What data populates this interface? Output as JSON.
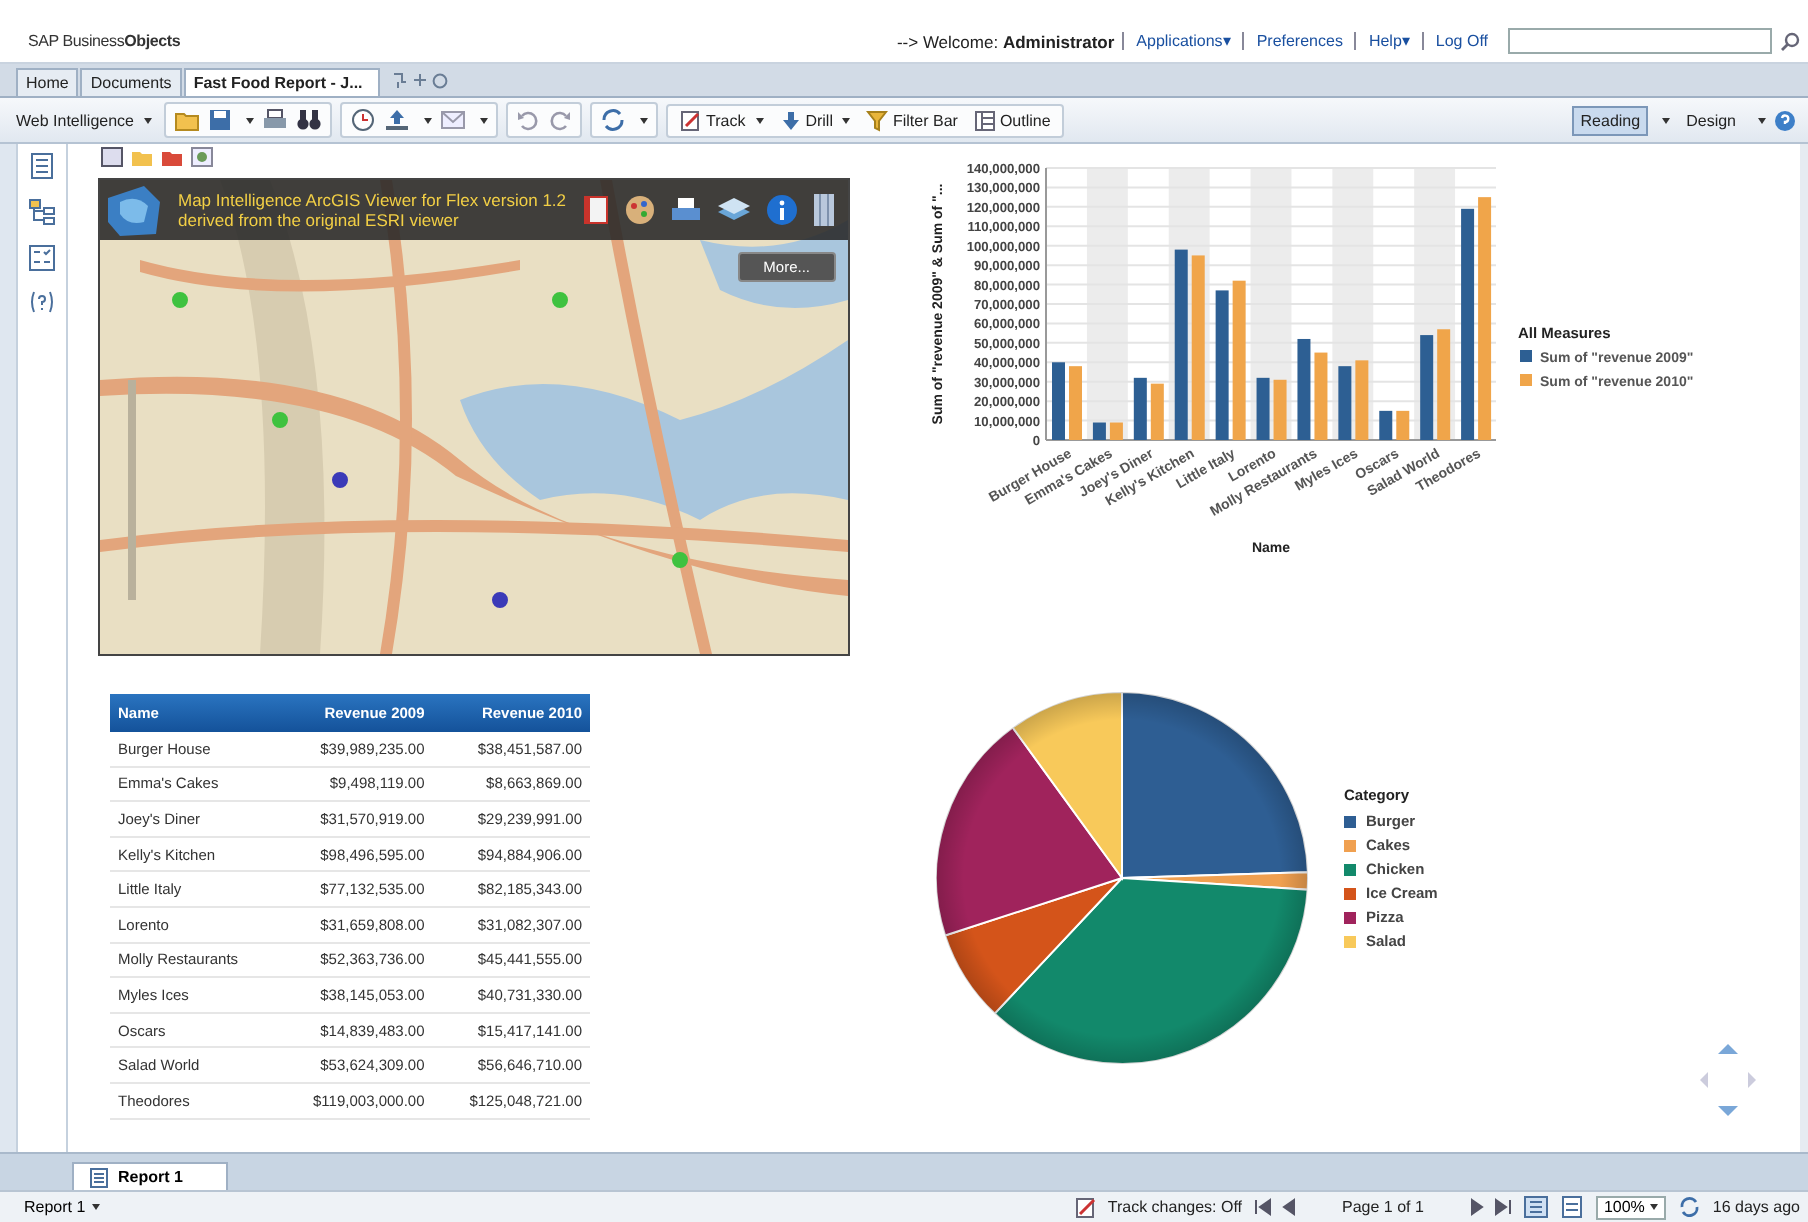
{
  "header": {
    "logo": "SAP Business**Objects**",
    "welcome_prefix": "--> Welcome:",
    "user": "Administrator",
    "links": [
      {
        "label": "Applications▾"
      },
      {
        "label": "Preferences"
      },
      {
        "label": "Help▾"
      },
      {
        "label": "Log Off"
      }
    ]
  },
  "tabs": [
    {
      "label": "Home",
      "selected": false
    },
    {
      "label": "Documents",
      "selected": false
    },
    {
      "label": "Fast Food Report - J...",
      "selected": true
    }
  ],
  "toolbar": {
    "app_menu": "Web Intelligence",
    "tools": [
      "Track",
      "Drill",
      "Filter Bar",
      "Outline"
    ],
    "views": [
      {
        "label": "Reading",
        "selected": true
      },
      {
        "label": "Design",
        "selected": false
      }
    ]
  },
  "map": {
    "kind": "picture",
    "title": "Map Intelligence ArcGIS Viewer for Flex version 1.2",
    "subtitle": "derived from the original ESRI viewer",
    "more_button": "More..."
  },
  "bar_chart": {
    "legend_title": "All Measures",
    "chart_data": {
      "type": "bar",
      "xlabel": "Name",
      "ylabel": "Sum of \"revenue 2009\" & Sum of \"...",
      "categories": [
        "Burger House",
        "Emma's Cakes",
        "Joey's Diner",
        "Kelly's Kitchen",
        "Little Italy",
        "Lorento",
        "Molly Restaurants",
        "Myles Ices",
        "Oscars",
        "Salad World",
        "Theodores"
      ],
      "series": [
        {
          "name": "Sum of \"revenue 2009\"",
          "color": "#2d5f93",
          "values": [
            40000000,
            9000000,
            32000000,
            98000000,
            77000000,
            32000000,
            52000000,
            38000000,
            15000000,
            54000000,
            119000000
          ]
        },
        {
          "name": "Sum of \"revenue 2010\"",
          "color": "#f0a54a",
          "values": [
            38000000,
            9000000,
            29000000,
            95000000,
            82000000,
            31000000,
            45000000,
            41000000,
            15000000,
            57000000,
            125000000
          ]
        }
      ],
      "grid": true,
      "legend": true,
      "ylim": [
        0,
        140000000
      ],
      "yticks": [
        {
          "value": 0,
          "label": "0"
        },
        {
          "value": 10000000,
          "label": "10,000,000"
        },
        {
          "value": 20000000,
          "label": "20,000,000"
        },
        {
          "value": 30000000,
          "label": "30,000,000"
        },
        {
          "value": 40000000,
          "label": "40,000,000"
        },
        {
          "value": 50000000,
          "label": "50,000,000"
        },
        {
          "value": 60000000,
          "label": "60,000,000"
        },
        {
          "value": 70000000,
          "label": "70,000,000"
        },
        {
          "value": 80000000,
          "label": "80,000,000"
        },
        {
          "value": 90000000,
          "label": "90,000,000"
        },
        {
          "value": 100000000,
          "label": "100,000,000"
        },
        {
          "value": 110000000,
          "label": "110,000,000"
        },
        {
          "value": 120000000,
          "label": "120,000,000"
        },
        {
          "value": 130000000,
          "label": "130,000,000"
        },
        {
          "value": 140000000,
          "label": "140,000,000"
        }
      ]
    }
  },
  "table": {
    "columns": [
      "Name",
      "Revenue 2009",
      "Revenue 2010"
    ],
    "rows": [
      [
        "Burger House",
        "$39,989,235.00",
        "$38,451,587.00"
      ],
      [
        "Emma's Cakes",
        "$9,498,119.00",
        "$8,663,869.00"
      ],
      [
        "Joey's Diner",
        "$31,570,919.00",
        "$29,239,991.00"
      ],
      [
        "Kelly's Kitchen",
        "$98,496,595.00",
        "$94,884,906.00"
      ],
      [
        "Little Italy",
        "$77,132,535.00",
        "$82,185,343.00"
      ],
      [
        "Lorento",
        "$31,659,808.00",
        "$31,082,307.00"
      ],
      [
        "Molly Restaurants",
        "$52,363,736.00",
        "$45,441,555.00"
      ],
      [
        "Myles Ices",
        "$38,145,053.00",
        "$40,731,330.00"
      ],
      [
        "Oscars",
        "$14,839,483.00",
        "$15,417,141.00"
      ],
      [
        "Salad World",
        "$53,624,309.00",
        "$56,646,710.00"
      ],
      [
        "Theodores",
        "$119,003,000.00",
        "$125,048,721.00"
      ]
    ]
  },
  "pie": {
    "legend_title": "Category",
    "items": [
      {
        "label": "Burger",
        "color": "#2e5e93"
      },
      {
        "label": "Cakes",
        "color": "#f0a050"
      },
      {
        "label": "Chicken",
        "color": "#12896b"
      },
      {
        "label": "Ice Cream",
        "color": "#d4541a"
      },
      {
        "label": "Pizza",
        "color": "#a0235c"
      },
      {
        "label": "Salad",
        "color": "#f8c95a"
      }
    ]
  },
  "report_tabs": [
    {
      "label": "Report 1",
      "selected": true
    }
  ],
  "status_bar": {
    "report_menu": "Report 1",
    "track_changes": "Track changes: Off",
    "page": "Page 1 of 1",
    "zoom": "100%",
    "last_refresh": "16 days ago"
  }
}
